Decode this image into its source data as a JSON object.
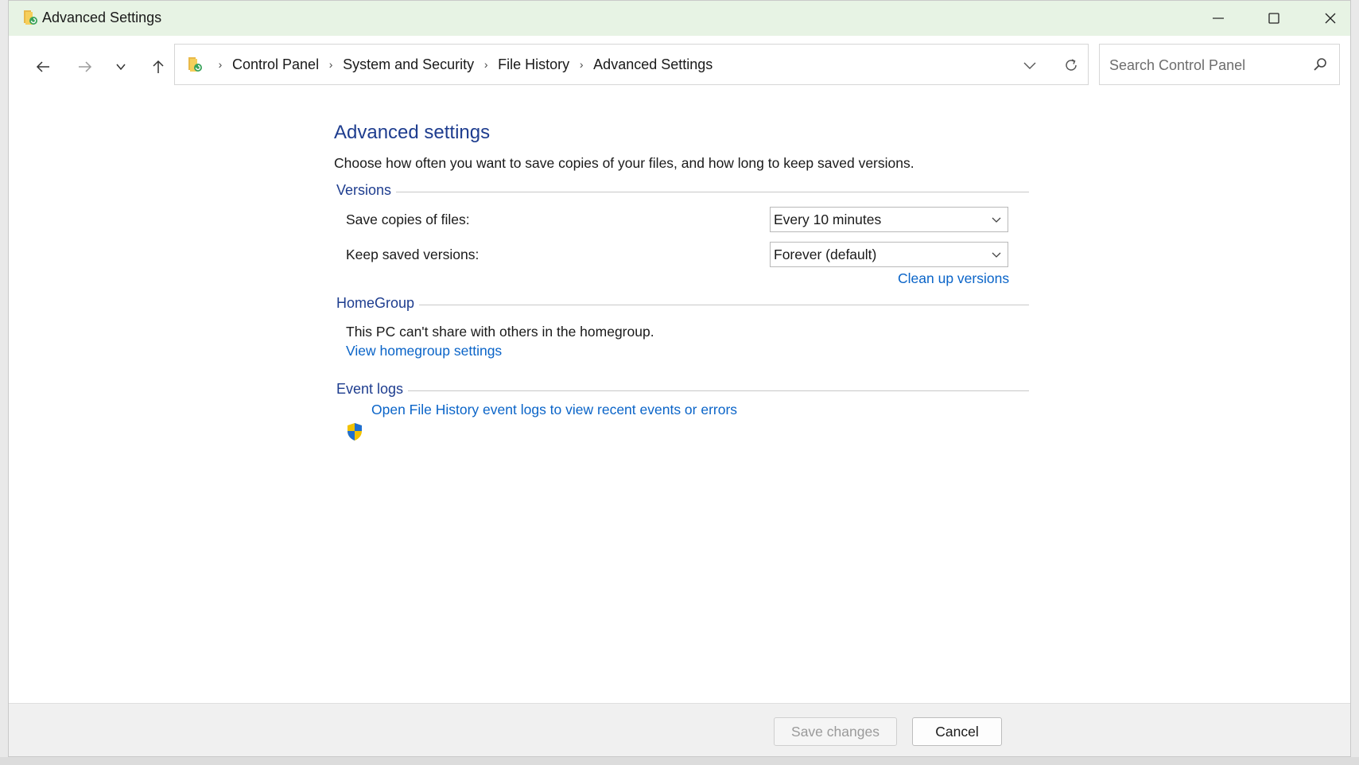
{
  "window": {
    "title": "Advanced Settings",
    "titlebar_color": "#e7f3e4"
  },
  "nav": {
    "breadcrumbs": [
      "Control Panel",
      "System and Security",
      "File History",
      "Advanced Settings"
    ],
    "search_placeholder": "Search Control Panel"
  },
  "main": {
    "heading": "Advanced settings",
    "intro": "Choose how often you want to save copies of your files, and how long to keep saved versions.",
    "versions": {
      "label": "Versions",
      "save_copies_label": "Save copies of files:",
      "save_copies_value": "Every 10 minutes",
      "keep_versions_label": "Keep saved versions:",
      "keep_versions_value": "Forever (default)",
      "cleanup_link": "Clean up versions"
    },
    "homegroup": {
      "label": "HomeGroup",
      "status": "This PC can't share with others in the homegroup.",
      "settings_link": "View homegroup settings"
    },
    "event_logs": {
      "label": "Event logs",
      "link": "Open File History event logs to view recent events or errors"
    }
  },
  "footer": {
    "save_label": "Save changes",
    "cancel_label": "Cancel"
  },
  "colors": {
    "heading": "#1e3d8f",
    "link": "#0a64c8"
  }
}
